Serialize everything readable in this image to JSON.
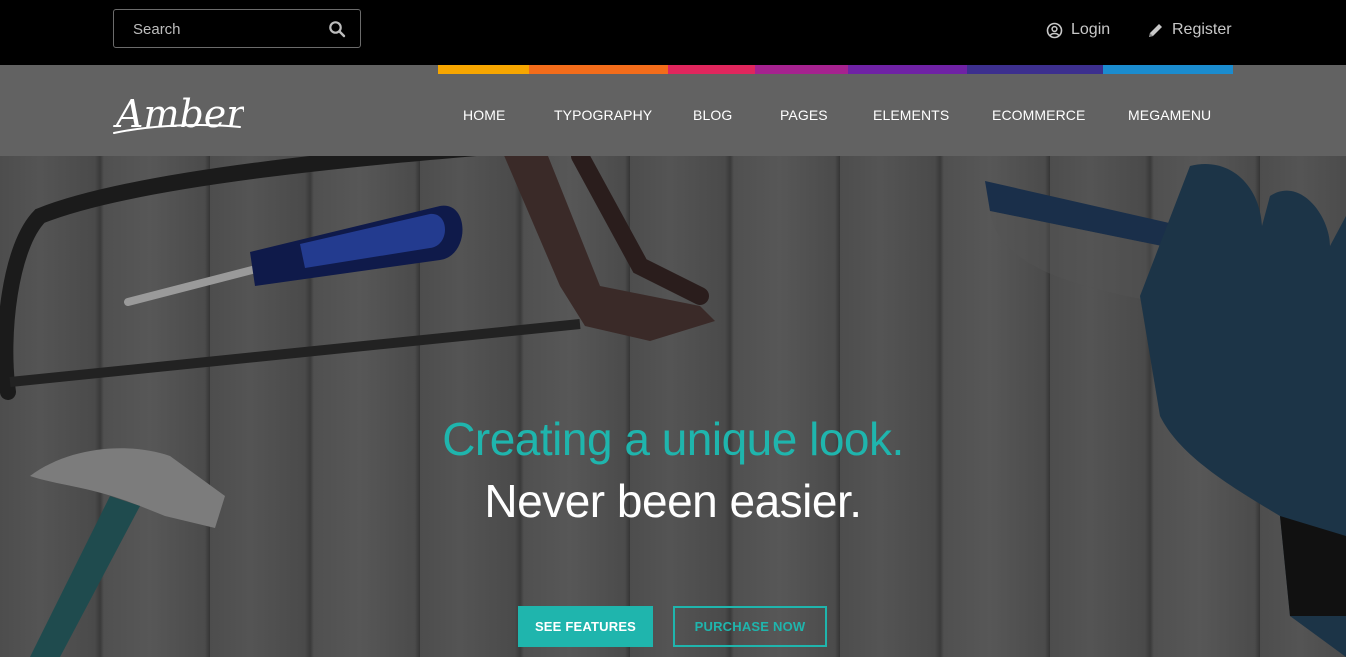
{
  "header": {
    "search": {
      "placeholder": "Search",
      "icon": "search-icon"
    },
    "login_label": "Login",
    "register_label": "Register"
  },
  "brand": {
    "logo_text": "Amber",
    "stripe_colors": [
      "#f7a600",
      "#f36c1a",
      "#e0265d",
      "#a6228f",
      "#6f22a5",
      "#3c2f8e",
      "#1b8ccf"
    ]
  },
  "nav": {
    "items": [
      "HOME",
      "TYPOGRAPHY",
      "BLOG",
      "PAGES",
      "ELEMENTS",
      "ECOMMERCE",
      "MEGAMENU"
    ]
  },
  "hero": {
    "headline_accent": "Creating a unique look.",
    "headline_main": "Never been easier.",
    "primary_button": "SEE FEATURES",
    "secondary_button": "PURCHASE NOW"
  },
  "colors": {
    "accent": "#1fb5ad",
    "topbar": "#000000",
    "navbar": "#626262"
  }
}
